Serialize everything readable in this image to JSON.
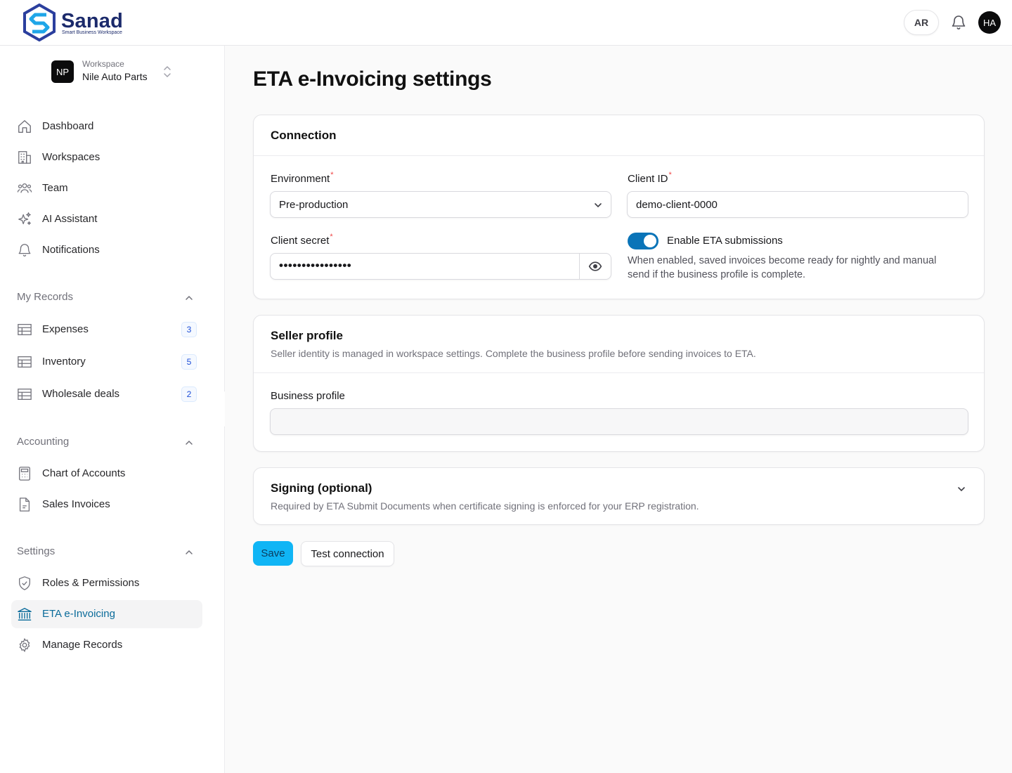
{
  "header": {
    "brand_name": "Sanad",
    "brand_tagline": "Smart Business Workspace",
    "language_button": "AR",
    "user_initials": "HA"
  },
  "sidebar": {
    "workspace": {
      "label": "Workspace",
      "initials": "NP",
      "name": "Nile Auto Parts"
    },
    "main_items": [
      {
        "label": "Dashboard",
        "icon": "home-icon"
      },
      {
        "label": "Workspaces",
        "icon": "building-icon"
      },
      {
        "label": "Team",
        "icon": "users-icon"
      },
      {
        "label": "AI Assistant",
        "icon": "sparkles-icon"
      },
      {
        "label": "Notifications",
        "icon": "bell-icon"
      }
    ],
    "sections": [
      {
        "title": "My Records",
        "items": [
          {
            "label": "Expenses",
            "count": "3",
            "icon": "table-icon"
          },
          {
            "label": "Inventory",
            "count": "5",
            "icon": "table-icon"
          },
          {
            "label": "Wholesale deals",
            "count": "2",
            "icon": "table-icon"
          }
        ]
      },
      {
        "title": "Accounting",
        "items": [
          {
            "label": "Chart of Accounts",
            "icon": "calculator-icon"
          },
          {
            "label": "Sales Invoices",
            "icon": "file-icon"
          }
        ]
      },
      {
        "title": "Settings",
        "items": [
          {
            "label": "Roles & Permissions",
            "icon": "shield-check-icon"
          },
          {
            "label": "ETA e-Invoicing",
            "icon": "landmark-icon",
            "active": true
          },
          {
            "label": "Manage Records",
            "icon": "gear-icon"
          }
        ]
      }
    ]
  },
  "main": {
    "page_title": "ETA e-Invoicing settings",
    "connection": {
      "title": "Connection",
      "environment_label": "Environment",
      "environment_value": "Pre-production",
      "client_id_label": "Client ID",
      "client_id_value": "demo-client-0000",
      "client_secret_label": "Client secret",
      "client_secret_value": "••••••••••••••••",
      "toggle_label": "Enable ETA submissions",
      "toggle_on": true,
      "toggle_help": "When enabled, saved invoices become ready for nightly and manual send if the business profile is complete."
    },
    "seller_profile": {
      "title": "Seller profile",
      "description": "Seller identity is managed in workspace settings. Complete the business profile before sending invoices to ETA.",
      "business_profile_label": "Business profile",
      "business_profile_value": ""
    },
    "signing": {
      "title": "Signing (optional)",
      "description": "Required by ETA Submit Documents when certificate signing is enforced for your ERP registration."
    },
    "actions": {
      "save_label": "Save",
      "test_label": "Test connection"
    }
  },
  "colors": {
    "accent": "#10b5f5",
    "toggle": "#0a74b8",
    "active_text": "#0a6b9a",
    "required": "#ef4444"
  }
}
